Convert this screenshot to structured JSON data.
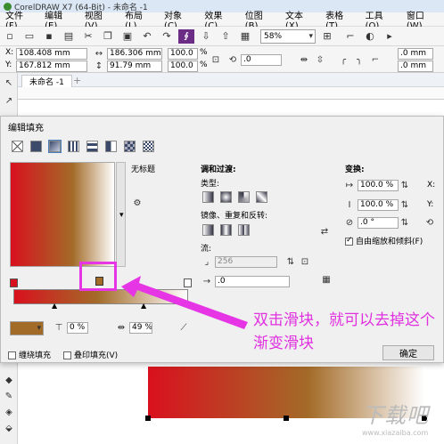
{
  "window": {
    "title": "CorelDRAW X7 (64-Bit) - 未命名 -1"
  },
  "menu": [
    "文件(F)",
    "编辑(E)",
    "视图(V)",
    "布局(L)",
    "对象(C)",
    "效果(C)",
    "位图(B)",
    "文本(X)",
    "表格(T)",
    "工具(O)",
    "窗口(W)"
  ],
  "toolbar": {
    "zoom": "58%"
  },
  "propbar": {
    "x": "108.408 mm",
    "y": "167.812 mm",
    "width": "186.306 mm",
    "height": "91.79 mm",
    "scale_x": "100.0",
    "scale_y": "100.0",
    "percent": "%",
    "rotation": ".0",
    "line_a": ".0 mm",
    "line_b": ".0 mm"
  },
  "doc_tab": "未命名 -1",
  "dialog": {
    "title": "编辑填充",
    "untitled": "无标题",
    "blend_heading": "调和过渡:",
    "type_label": "类型:",
    "mirror_label": "镜像、重复和反转:",
    "flow_label": "流:",
    "steps": "256",
    "accel": ".0",
    "transform_heading": "变换:",
    "t_width": "100.0 %",
    "t_height": "100.0 %",
    "t_skew": ".0 °",
    "t_x": "X:",
    "t_y": "Y:",
    "free_scale": "自由缩放和倾斜(F)",
    "opacity": "0 %",
    "position": "49 %",
    "wrap_fill": "缠绕填充",
    "overprint_fill": "叠印填充(V)",
    "ok": "确定"
  },
  "annotation": "双击滑块，就可以去掉这个渐变滑块",
  "watermark": {
    "main": "下载吧",
    "url": "www.xiazaiba.com"
  },
  "colors": {
    "start": "#d9101e",
    "mid": "#a36b28",
    "end": "#ffffff",
    "highlight": "#e535e5"
  }
}
